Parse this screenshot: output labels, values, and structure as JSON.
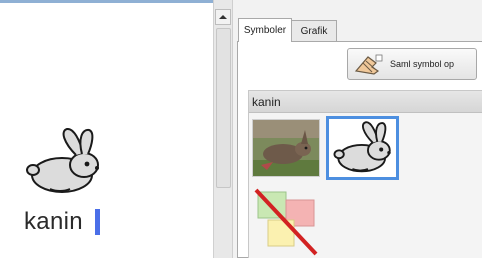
{
  "document": {
    "word": "kanin",
    "symbol_icon": "rabbit-symbol-icon"
  },
  "scrollbar": {
    "up_icon": "scroll-up-arrow-icon"
  },
  "panel": {
    "tabs": [
      {
        "label": "Symboler",
        "active": true
      },
      {
        "label": "Grafik",
        "active": false
      }
    ],
    "collect_button": {
      "label": "Saml symbol op",
      "icon": "hand-pickup-icon"
    },
    "results": {
      "query": "kanin",
      "items": [
        {
          "kind": "photo",
          "icon": "rabbit-photo",
          "selected": false
        },
        {
          "kind": "symbol",
          "icon": "rabbit-symbol-icon",
          "selected": true
        },
        {
          "kind": "no-symbol",
          "icon": "no-symbol-icon",
          "selected": false
        }
      ]
    }
  },
  "colors": {
    "caret": "#4a6fe8",
    "selection_border": "#4d8fe0",
    "doc_top_border": "#8fb0d4"
  }
}
